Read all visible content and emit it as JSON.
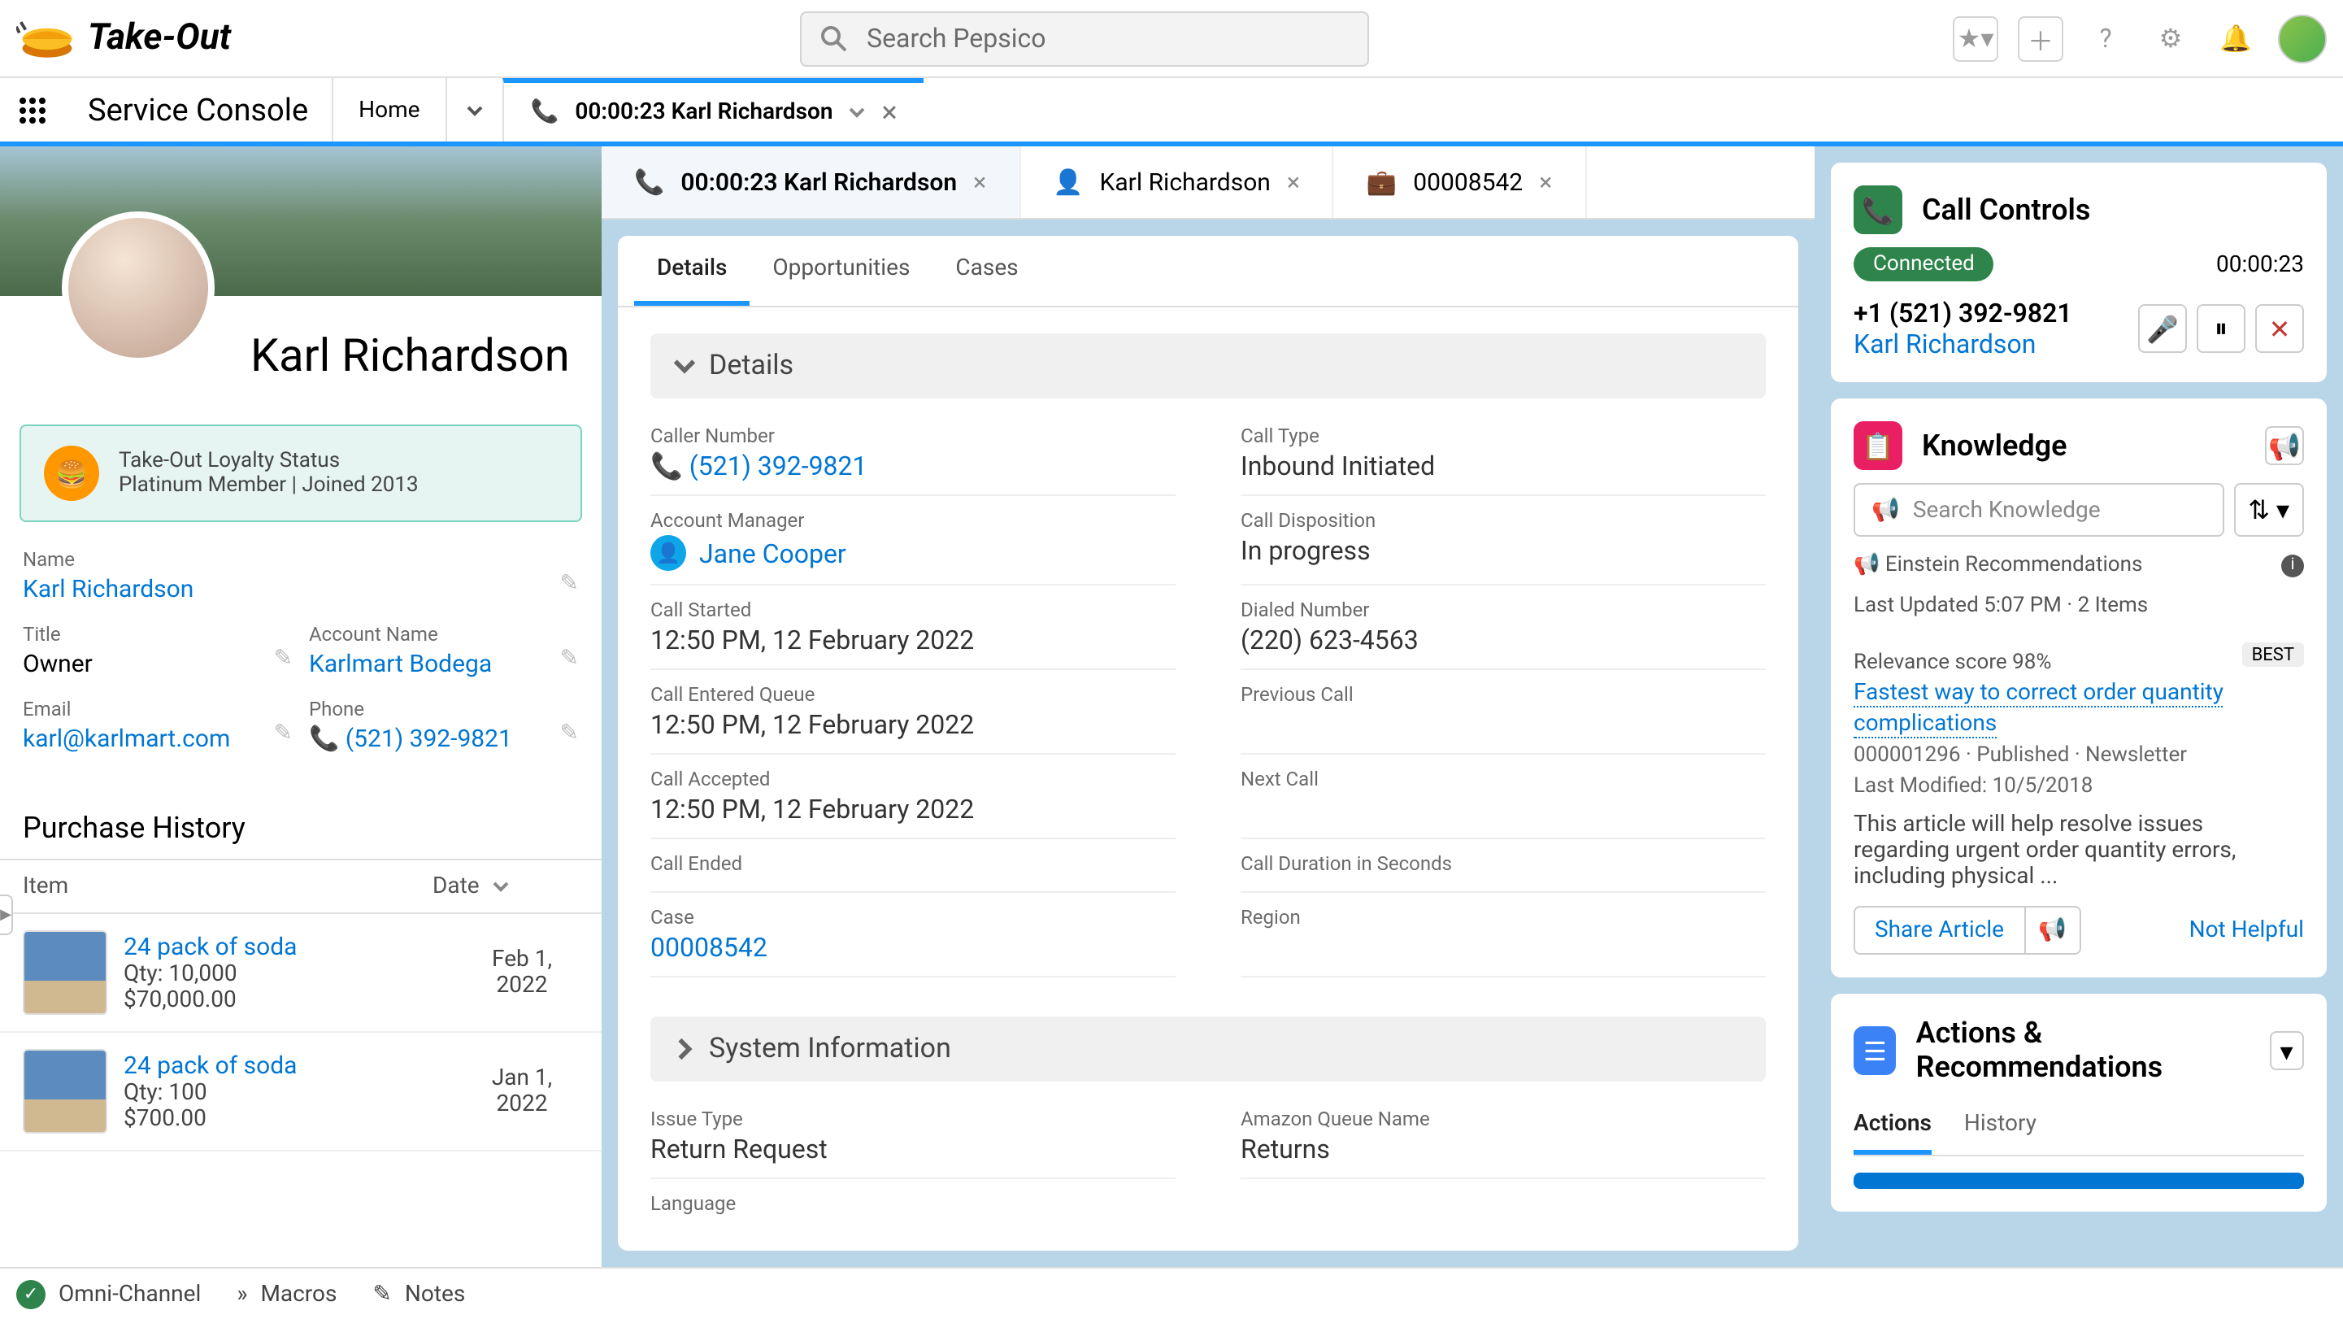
{
  "header": {
    "brand": "Take-Out",
    "search_placeholder": "Search Pepsico"
  },
  "tabbar": {
    "app_name": "Service Console",
    "tabs": [
      {
        "label": "Home"
      },
      {
        "label": "00:00:23 Karl Richardson",
        "active": true
      }
    ]
  },
  "subtabs": [
    {
      "label": "00:00:23 Karl Richardson",
      "active": true,
      "icon": "phone"
    },
    {
      "label": "Karl Richardson",
      "icon": "contact"
    },
    {
      "label": "00008542",
      "icon": "case"
    }
  ],
  "customer": {
    "name": "Karl Richardson",
    "loyalty_title": "Take-Out Loyalty Status",
    "loyalty_detail": "Platinum Member | Joined 2013",
    "fields": {
      "name_label": "Name",
      "name_value": "Karl Richardson",
      "title_label": "Title",
      "title_value": "Owner",
      "account_label": "Account Name",
      "account_value": "Karlmart Bodega",
      "email_label": "Email",
      "email_value": "karl@karlmart.com",
      "phone_label": "Phone",
      "phone_value": "(521) 392-9821"
    },
    "purchase_title": "Purchase History",
    "ph_cols": {
      "item": "Item",
      "date": "Date"
    },
    "purchases": [
      {
        "name": "24 pack of soda",
        "qty": "Qty: 10,000",
        "amount": "$70,000.00",
        "date": "Feb 1, 2022"
      },
      {
        "name": "24 pack of soda",
        "qty": "Qty: 100",
        "amount": "$700.00",
        "date": "Jan 1, 2022"
      }
    ]
  },
  "center": {
    "tabs": {
      "details": "Details",
      "opps": "Opportunities",
      "cases": "Cases"
    },
    "details_title": "Details",
    "sysinfo_title": "System Information",
    "fields": {
      "caller_number_l": "Caller Number",
      "caller_number_v": "(521) 392-9821",
      "call_type_l": "Call Type",
      "call_type_v": "Inbound Initiated",
      "acct_mgr_l": "Account Manager",
      "acct_mgr_v": "Jane Cooper",
      "call_disp_l": "Call Disposition",
      "call_disp_v": "In progress",
      "call_started_l": "Call Started",
      "call_started_v": "12:50 PM, 12 February 2022",
      "dialed_l": "Dialed Number",
      "dialed_v": "(220) 623-4563",
      "entered_q_l": "Call Entered Queue",
      "entered_q_v": "12:50 PM, 12 February 2022",
      "prev_call_l": "Previous Call",
      "prev_call_v": "",
      "accepted_l": "Call Accepted",
      "accepted_v": "12:50 PM, 12 February 2022",
      "next_call_l": "Next Call",
      "next_call_v": "",
      "ended_l": "Call Ended",
      "ended_v": "",
      "duration_l": "Call Duration in Seconds",
      "duration_v": "",
      "case_l": "Case",
      "case_v": "00008542",
      "region_l": "Region",
      "region_v": "",
      "issue_l": "Issue Type",
      "issue_v": "Return Request",
      "aqueue_l": "Amazon Queue Name",
      "aqueue_v": "Returns",
      "lang_l": "Language"
    }
  },
  "call_controls": {
    "title": "Call Controls",
    "status": "Connected",
    "timer": "00:00:23",
    "phone": "+1 (521) 392-9821",
    "name": "Karl Richardson"
  },
  "knowledge": {
    "title": "Knowledge",
    "search_placeholder": "Search Knowledge",
    "rec_label": "Einstein Recommendations",
    "updated": "Last Updated 5:07 PM · 2 Items",
    "relevance": "Relevance score 98%",
    "best": "BEST",
    "article_title": "Fastest way to correct order quantity complications",
    "article_meta": "000001296  ·  Published  ·  Newsletter",
    "article_modified": "Last Modified: 10/5/2018",
    "article_desc": "This article will help resolve issues regarding urgent order quantity errors, including physical ...",
    "share": "Share Article",
    "not_helpful": "Not Helpful"
  },
  "actions": {
    "title": "Actions & Recommendations",
    "tabs": {
      "actions": "Actions",
      "history": "History"
    }
  },
  "footer": {
    "omni": "Omni-Channel",
    "macros": "Macros",
    "notes": "Notes"
  }
}
